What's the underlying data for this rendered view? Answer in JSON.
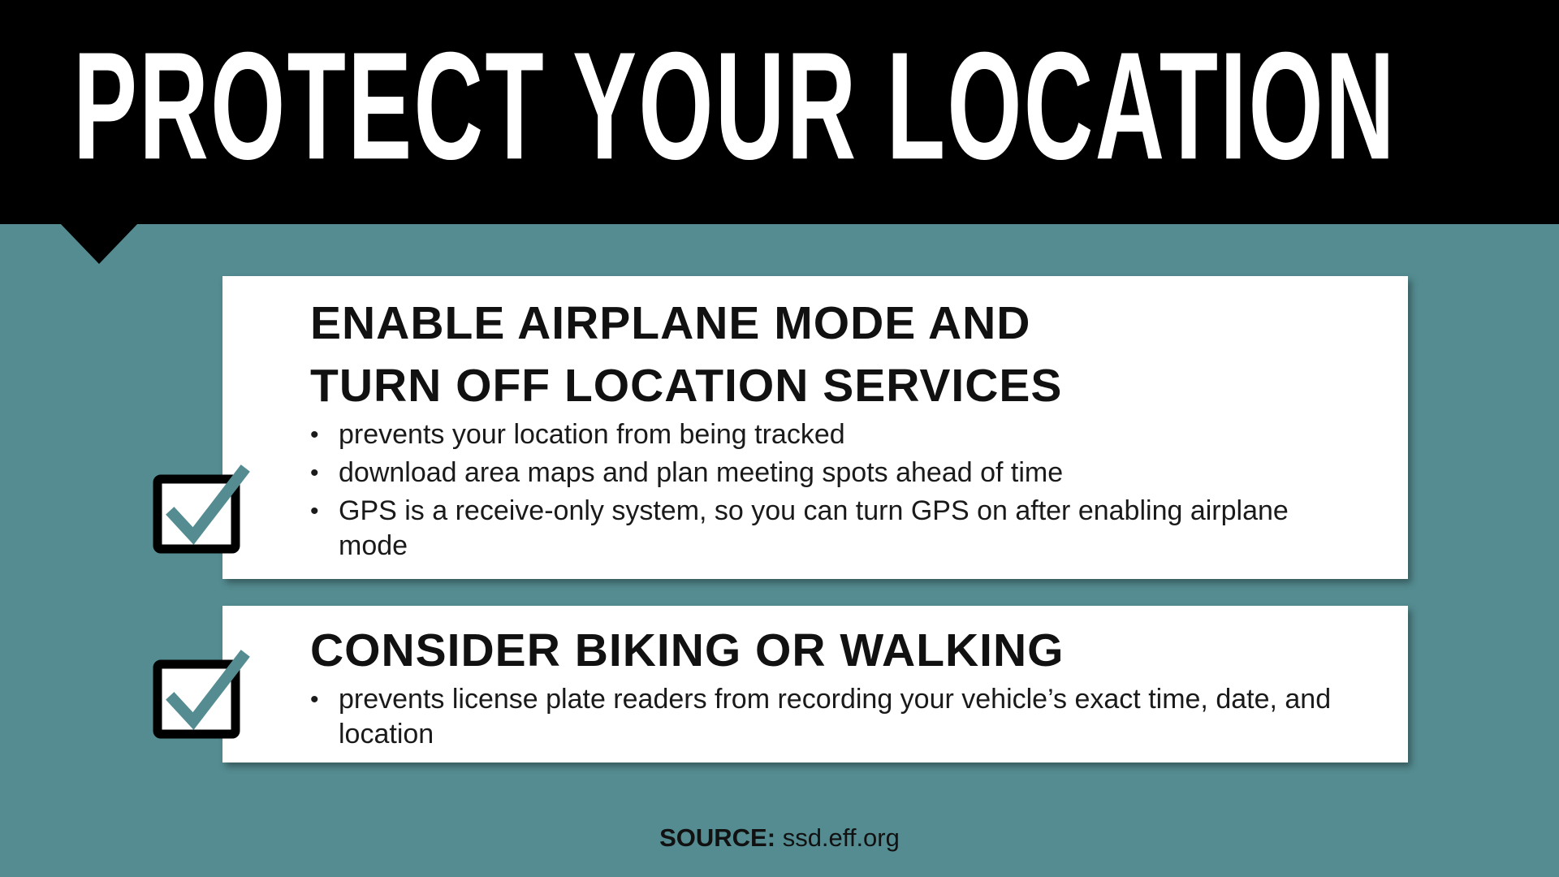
{
  "header": {
    "title": "PROTECT YOUR LOCATION"
  },
  "colors": {
    "background": "#548c91",
    "header": "#000000",
    "card": "#ffffff",
    "check_accent": "#548c91"
  },
  "icons": {
    "checkbox": "checked-box-icon"
  },
  "cards": [
    {
      "heading_lines": [
        "ENABLE AIRPLANE MODE AND",
        "TURN OFF LOCATION SERVICES"
      ],
      "bullets": [
        "prevents your location from being tracked",
        "download area maps and plan meeting spots ahead of time",
        "GPS is a receive-only system, so you can turn GPS on after enabling airplane mode"
      ]
    },
    {
      "heading_lines": [
        "CONSIDER BIKING OR WALKING"
      ],
      "bullets": [
        "prevents license plate readers from recording your vehicle’s exact time, date, and location"
      ]
    }
  ],
  "footer": {
    "source_label": "SOURCE:",
    "source_value": "ssd.eff.org"
  }
}
